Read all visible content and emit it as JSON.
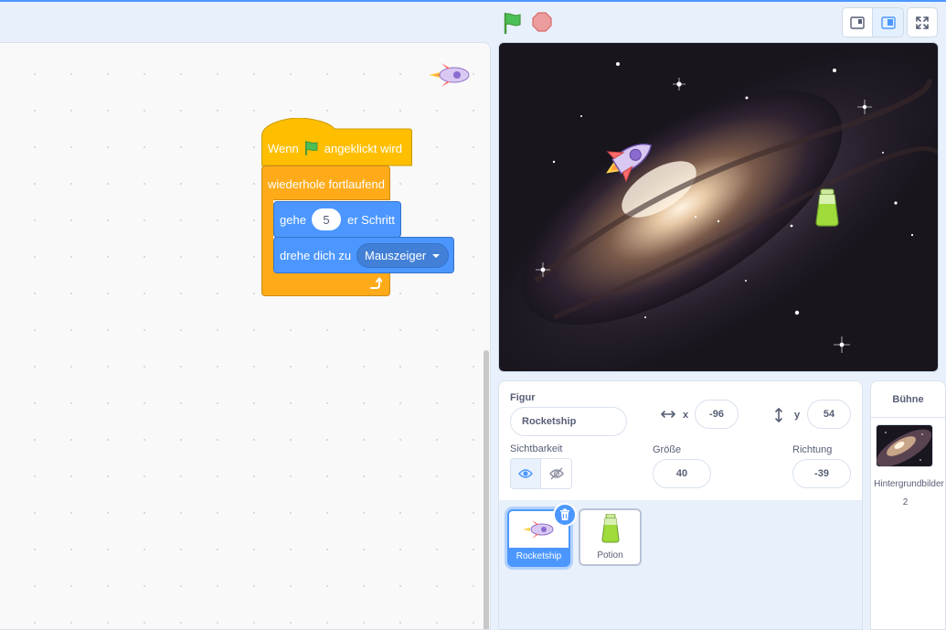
{
  "colors": {
    "accent": "#4c97ff",
    "control": "#ffab19",
    "motion": "#4c97ff",
    "event": "#ffbf00",
    "stop": "#ec9c9c",
    "flag": "#4cbf56"
  },
  "header": {
    "green_flag_icon": "green-flag-icon",
    "stop_icon": "stop-sign-icon",
    "layout_small": "small-stage-icon",
    "layout_normal": "normal-stage-icon",
    "fullscreen": "fullscreen-icon"
  },
  "script": {
    "hat": {
      "prefix": "Wenn",
      "suffix": "angeklickt wird"
    },
    "forever": {
      "label": "wiederhole fortlaufend"
    },
    "move": {
      "prefix": "gehe",
      "value": "5",
      "suffix": "er Schritt"
    },
    "turn_towards": {
      "prefix": "drehe dich zu",
      "target": "Mauszeiger"
    }
  },
  "sprite_info": {
    "figure_label": "Figur",
    "sprite_name": "Rocketship",
    "x_label": "x",
    "x_value": "-96",
    "y_label": "y",
    "y_value": "54",
    "visibility_label": "Sichtbarkeit",
    "size_label": "Größe",
    "size_value": "40",
    "direction_label": "Richtung",
    "direction_value": "-39"
  },
  "sprites": [
    {
      "name": "Rocketship",
      "selected": true
    },
    {
      "name": "Potion",
      "selected": false
    }
  ],
  "stage_panel": {
    "title": "Bühne",
    "backdrops_label": "Hintergrundbilder",
    "backdrops_count": "2"
  }
}
